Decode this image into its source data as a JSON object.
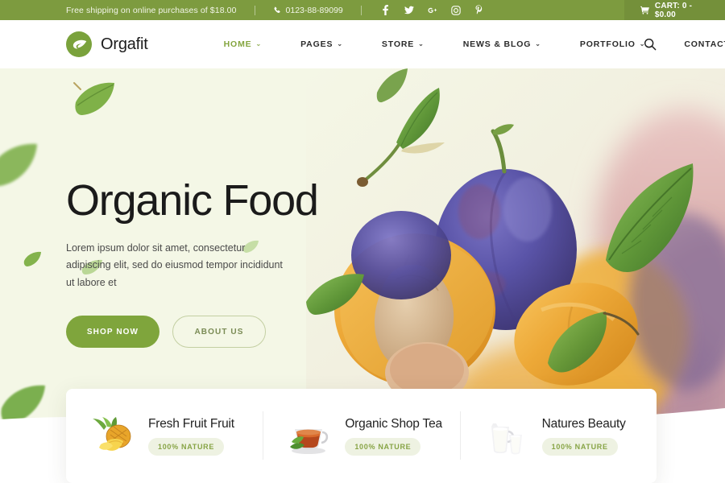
{
  "topbar": {
    "shipping_text": "Free shipping on online purchases of $18.00",
    "phone": "0123-88-89099",
    "phone_icon": "phone-icon",
    "social": [
      {
        "name": "facebook-icon",
        "label": "f"
      },
      {
        "name": "twitter-icon",
        "label": "t"
      },
      {
        "name": "google-plus-icon",
        "label": "G+"
      },
      {
        "name": "instagram-icon",
        "label": "ig"
      },
      {
        "name": "pinterest-icon",
        "label": "P"
      }
    ],
    "cart_label": "CART: 0 - $0.00",
    "cart_icon": "shopping-cart-icon",
    "bg_color": "#7d9b3f",
    "cart_bg_color": "#74903a"
  },
  "header": {
    "brand_name": "Orgafit",
    "logo_icon": "leaf-circle-logo",
    "search_icon": "search-icon",
    "nav": [
      {
        "label": "HOME",
        "has_dropdown": true,
        "active": true
      },
      {
        "label": "PAGES",
        "has_dropdown": true,
        "active": false
      },
      {
        "label": "STORE",
        "has_dropdown": true,
        "active": false
      },
      {
        "label": "NEWS & BLOG",
        "has_dropdown": true,
        "active": false
      },
      {
        "label": "PORTFOLIO",
        "has_dropdown": true,
        "active": false
      },
      {
        "label": "CONTACTS",
        "has_dropdown": false,
        "active": false
      }
    ],
    "chevron": "⌄",
    "accent_color": "#84a53f"
  },
  "hero": {
    "title": "Organic Food",
    "subtitle": "Lorem ipsum dolor sit amet, consectetur adipiscing elit, sed do eiusmod tempor incididunt ut labore et",
    "primary_button": "SHOP NOW",
    "secondary_button": "ABOUT US",
    "bg_color": "#f4f7e6",
    "image_alt": "plums-and-apricots-photo"
  },
  "features": [
    {
      "title": "Fresh Fruit Fruit",
      "badge": "100% NATURE",
      "icon": "pineapple-icon"
    },
    {
      "title": "Organic Shop Tea",
      "badge": "100% NATURE",
      "icon": "tea-cup-icon"
    },
    {
      "title": "Natures Beauty",
      "badge": "100% NATURE",
      "icon": "milk-jug-icon"
    }
  ]
}
